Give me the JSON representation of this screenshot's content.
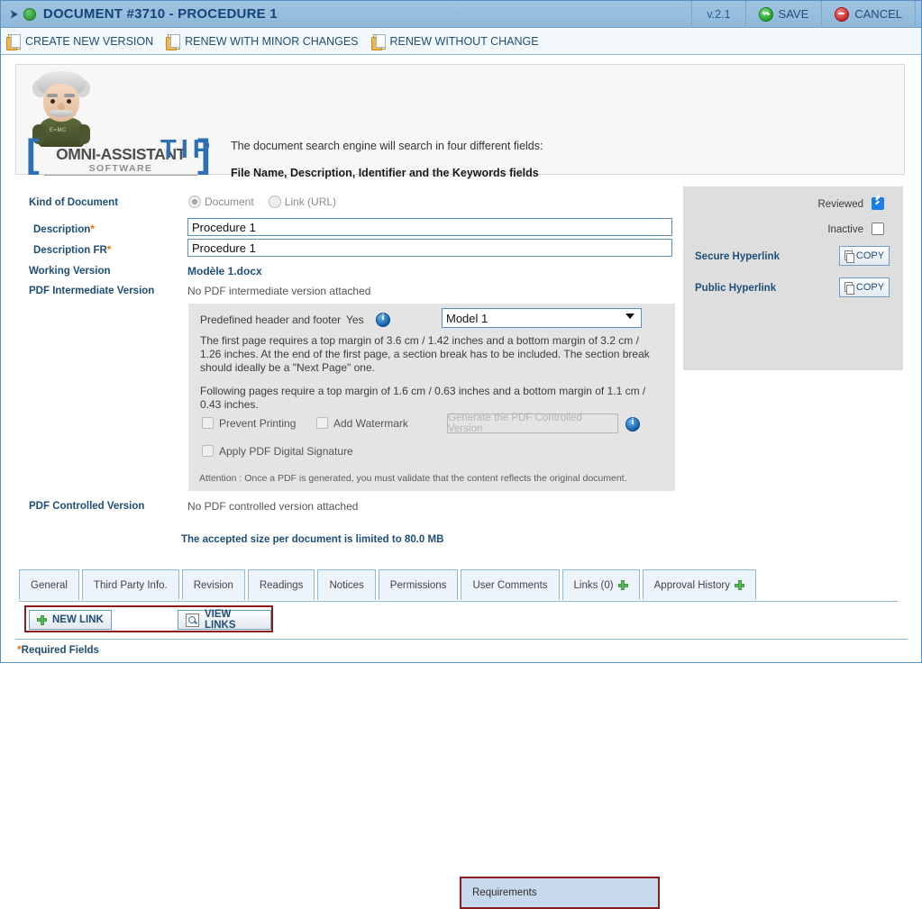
{
  "titlebar": {
    "expander_icon": "chevron-right-icon",
    "status_icon": "green-status-dot",
    "title": "DOCUMENT #3710 - PROCEDURE 1",
    "version": "v.2.1",
    "save_label": "SAVE",
    "cancel_label": "CANCEL"
  },
  "toolbar": {
    "buttons": [
      {
        "label": "CREATE NEW VERSION"
      },
      {
        "label": "RENEW WITH MINOR CHANGES"
      },
      {
        "label": "RENEW WITHOUT CHANGE"
      }
    ]
  },
  "tip": {
    "heading": "TIP",
    "line1": "The document search engine will search in four different fields:",
    "line2": "File Name, Description, Identifier and the Keywords fields",
    "brand_name": "OMNI-ASSISTANT",
    "brand_sub": "SOFTWARE",
    "avatar_shirt_text": "E=MC"
  },
  "form": {
    "kind_of_document_label": "Kind of Document",
    "kind_options": [
      {
        "label": "Document",
        "selected": true
      },
      {
        "label": "Link (URL)",
        "selected": false
      }
    ],
    "description_label": "Description",
    "description_value": "Procedure 1",
    "description_fr_label": "Description FR",
    "description_fr_value": "Procedure 1",
    "working_version_label": "Working Version",
    "working_version_value": "Modèle 1.docx",
    "pdf_intermediate_label": "PDF Intermediate Version",
    "pdf_intermediate_value": "No PDF intermediate version attached",
    "pdf_controlled_label": "PDF Controlled Version",
    "pdf_controlled_value": "No PDF controlled version attached",
    "required_marker": "*"
  },
  "right_panel": {
    "reviewed_label": "Reviewed",
    "reviewed_checked": true,
    "inactive_label": "Inactive",
    "inactive_checked": false,
    "secure_hyperlink_label": "Secure Hyperlink",
    "public_hyperlink_label": "Public Hyperlink",
    "copy_label": "COPY"
  },
  "pdf_settings": {
    "header_footer_label": "Predefined header and footer",
    "header_footer_value": "Yes",
    "model_selected": "Model 1",
    "model_options": [
      "Model 1"
    ],
    "paragraph1": "The first page requires a top margin of 3.6 cm / 1.42 inches and a bottom margin of 3.2 cm / 1.26 inches. At the end of the first page, a section break has to be included. The section break should ideally be a \"Next Page\" one.",
    "paragraph2": "Following pages require a top margin of 1.6 cm / 0.63 inches and a bottom margin of 1.1 cm / 0.43 inches.",
    "prevent_printing_label": "Prevent Printing",
    "prevent_printing_checked": false,
    "add_watermark_label": "Add Watermark",
    "add_watermark_checked": false,
    "apply_signature_label": "Apply PDF Digital Signature",
    "apply_signature_checked": false,
    "generate_button_label": "Generate the PDF Controlled Version",
    "generate_button_disabled": true,
    "attention_note": "Attention : Once a PDF is generated, you must validate that the content reflects the original document."
  },
  "bottom": {
    "size_note": "The accepted size per document is limited to 80.0 MB",
    "tabs": [
      {
        "label": "General",
        "selected": false,
        "plus": false
      },
      {
        "label": "Third Party Info.",
        "selected": false,
        "plus": false
      },
      {
        "label": "Revision",
        "selected": false,
        "plus": false
      },
      {
        "label": "Readings",
        "selected": false,
        "plus": false
      },
      {
        "label": "Notices",
        "selected": false,
        "plus": false
      },
      {
        "label": "Permissions",
        "selected": false,
        "plus": false
      },
      {
        "label": "User Comments",
        "selected": false,
        "plus": false
      },
      {
        "label": "Links (0)",
        "selected": false,
        "plus": true
      },
      {
        "label": "Approval History",
        "selected": false,
        "plus": true
      },
      {
        "label": "Requirements",
        "selected": true,
        "plus": false
      }
    ],
    "new_link_label": "NEW LINK",
    "view_links_label": "VIEW LINKS",
    "required_fields_label": "Required Fields",
    "required_marker": "*"
  },
  "colors": {
    "titlebar": "#9ec3e0",
    "title_text": "#15447a",
    "accent_blue": "#2d6fb5",
    "highlight_red": "#8b1a1a",
    "required_orange": "#e8700d",
    "panel_gray": "#dedede",
    "box_gray": "#e4e4e4"
  }
}
